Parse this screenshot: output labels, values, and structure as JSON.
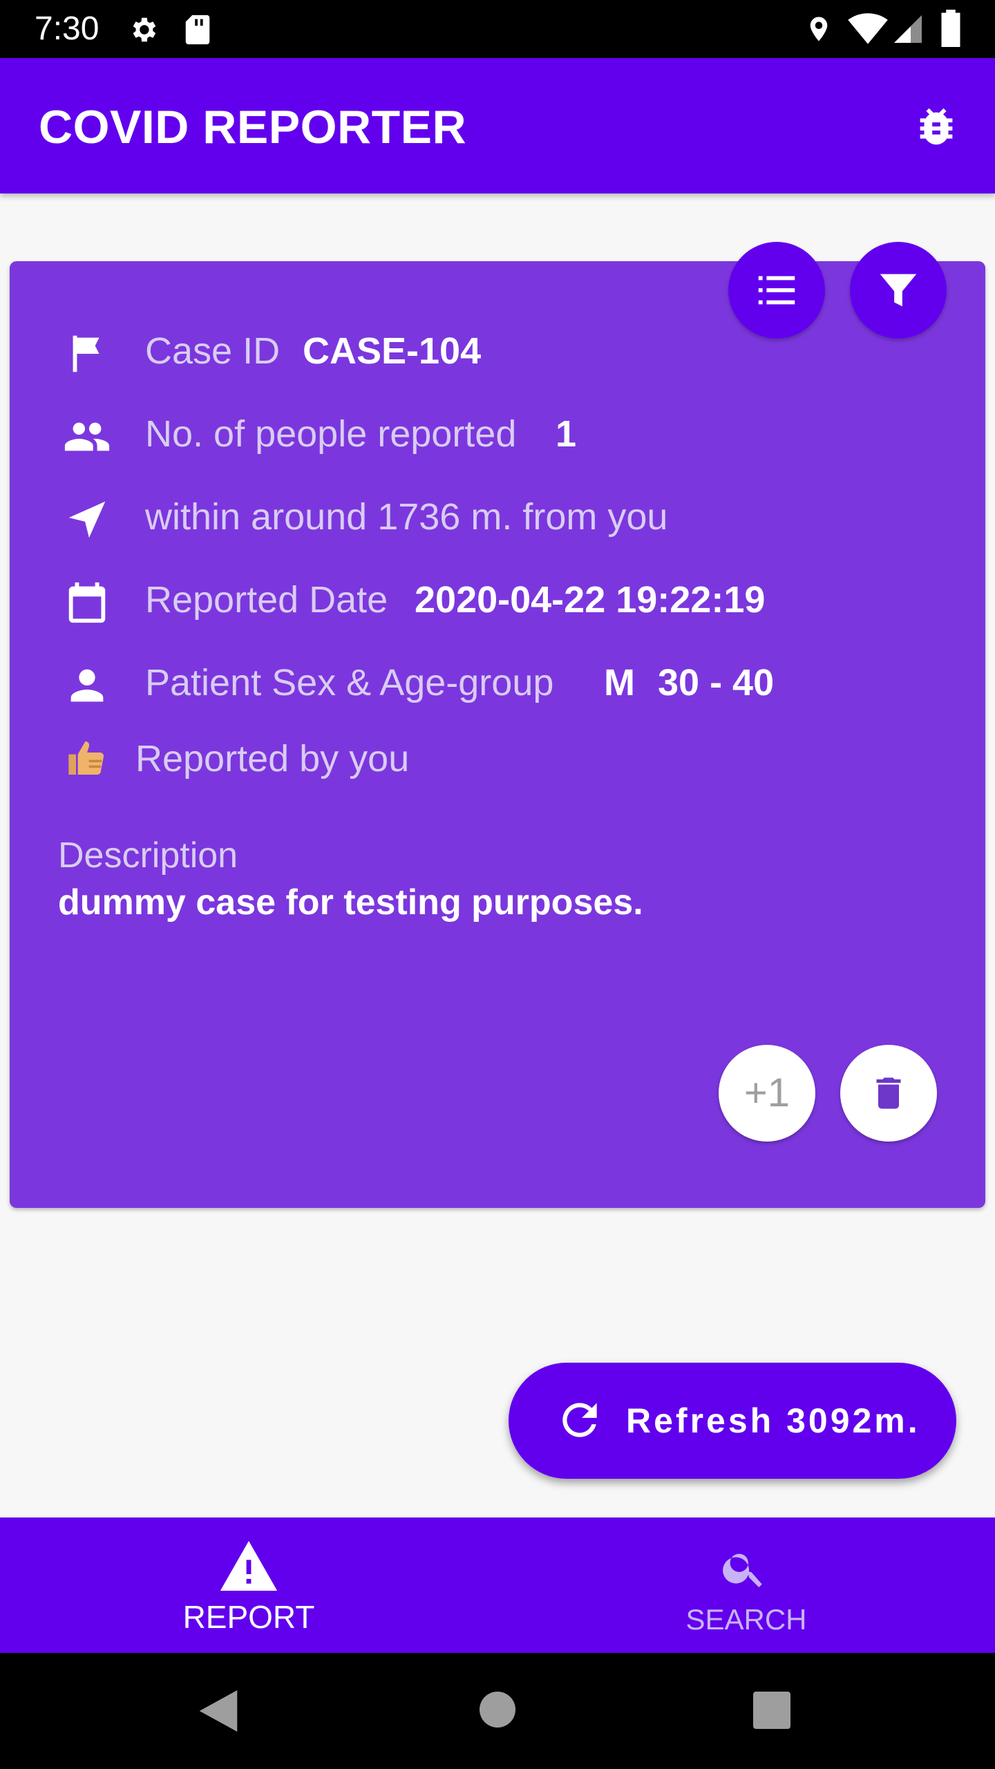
{
  "status_bar": {
    "time": "7:30"
  },
  "app_bar": {
    "title": "COVID REPORTER",
    "icons": [
      "bug-report-icon"
    ]
  },
  "case_card": {
    "top_buttons": [
      "list-icon",
      "filter-icon"
    ],
    "case_id": {
      "label": "Case ID",
      "value": "CASE-104"
    },
    "people_reported": {
      "label": "No. of people reported",
      "value": "1"
    },
    "distance_text": "within around 1736 m. from you",
    "reported_date": {
      "label": "Reported Date",
      "value": "2020-04-22 19:22:19"
    },
    "patient": {
      "label": "Patient Sex & Age-group",
      "sex": "M",
      "age_group": "30 - 40"
    },
    "reported_by": "Reported by you",
    "description": {
      "label": "Description",
      "value": "dummy case for testing purposes."
    },
    "actions": {
      "plus_one": "+1"
    }
  },
  "refresh_button": {
    "label": "Refresh 3092m."
  },
  "bottom_nav": {
    "items": [
      {
        "label": "REPORT",
        "icon": "warning-icon",
        "active": true
      },
      {
        "label": "SEARCH",
        "icon": "search-icon",
        "active": false
      }
    ]
  },
  "colors": {
    "primary": "#6200ee",
    "card": "#7b37dd",
    "muted_text": "#d9ccf3",
    "background": "#f7f7f7"
  }
}
